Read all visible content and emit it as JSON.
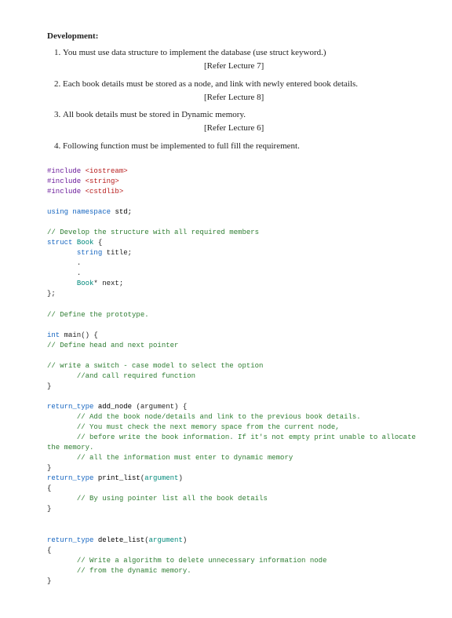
{
  "heading": "Development:",
  "items": [
    {
      "text": "You must use data structure to implement the database (use struct keyword.)",
      "ref": "[Refer Lecture 7]"
    },
    {
      "text": "Each book details must be stored as a node, and link with newly entered book details.",
      "ref": "[Refer Lecture 8]"
    },
    {
      "text": "All book details must be stored in Dynamic memory.",
      "ref": "[Refer Lecture 6]"
    },
    {
      "text": "Following function must be implemented to full fill the requirement.",
      "ref": ""
    }
  ],
  "code": {
    "inc1": "#include ",
    "inc1h": "<iostream>",
    "inc2": "#include ",
    "inc2h": "<string>",
    "inc3": "#include ",
    "inc3h": "<cstdlib>",
    "using": "using",
    "namespace": "namespace",
    "std": "std;",
    "cmt_struct": "// Develop the structure with all required members",
    "struct_kw": "struct",
    "book_t": "Book",
    "brace_open": "{",
    "string_kw": "string",
    "title": "title;",
    "dot": ".",
    "book_ptr": "Book",
    "star_next": "* next;",
    "brace_close_semi": "};",
    "cmt_proto": "// Define the prototype.",
    "int_kw": "int",
    "main_fn": "main()",
    "cmt_head": "// Define head and next pointer",
    "cmt_switch1": "// write a switch - case model to select the option",
    "cmt_switch2": "//and call required function",
    "brace_close": "}",
    "rettype": "return_type",
    "add_node": "add_node",
    "arg_paren": "(argument)",
    "argument": "argument",
    "cmt_add1": "// Add the book node/details and link to the previous book details.",
    "cmt_add2": "// You must check the next memory space from the current node,",
    "cmt_add3": "// before write the book information. If it's not empty print unable to allocate",
    "cmt_add3b": "the memory.",
    "cmt_add4": "// all the information must enter to dynamic memory",
    "print_list": "print_list",
    "cmt_print": "// By using pointer list all the book details",
    "delete_list": "delete_list",
    "cmt_del1": "// Write a algorithm to delete unnecessary information node",
    "cmt_del2": "// from the dynamic memory."
  }
}
